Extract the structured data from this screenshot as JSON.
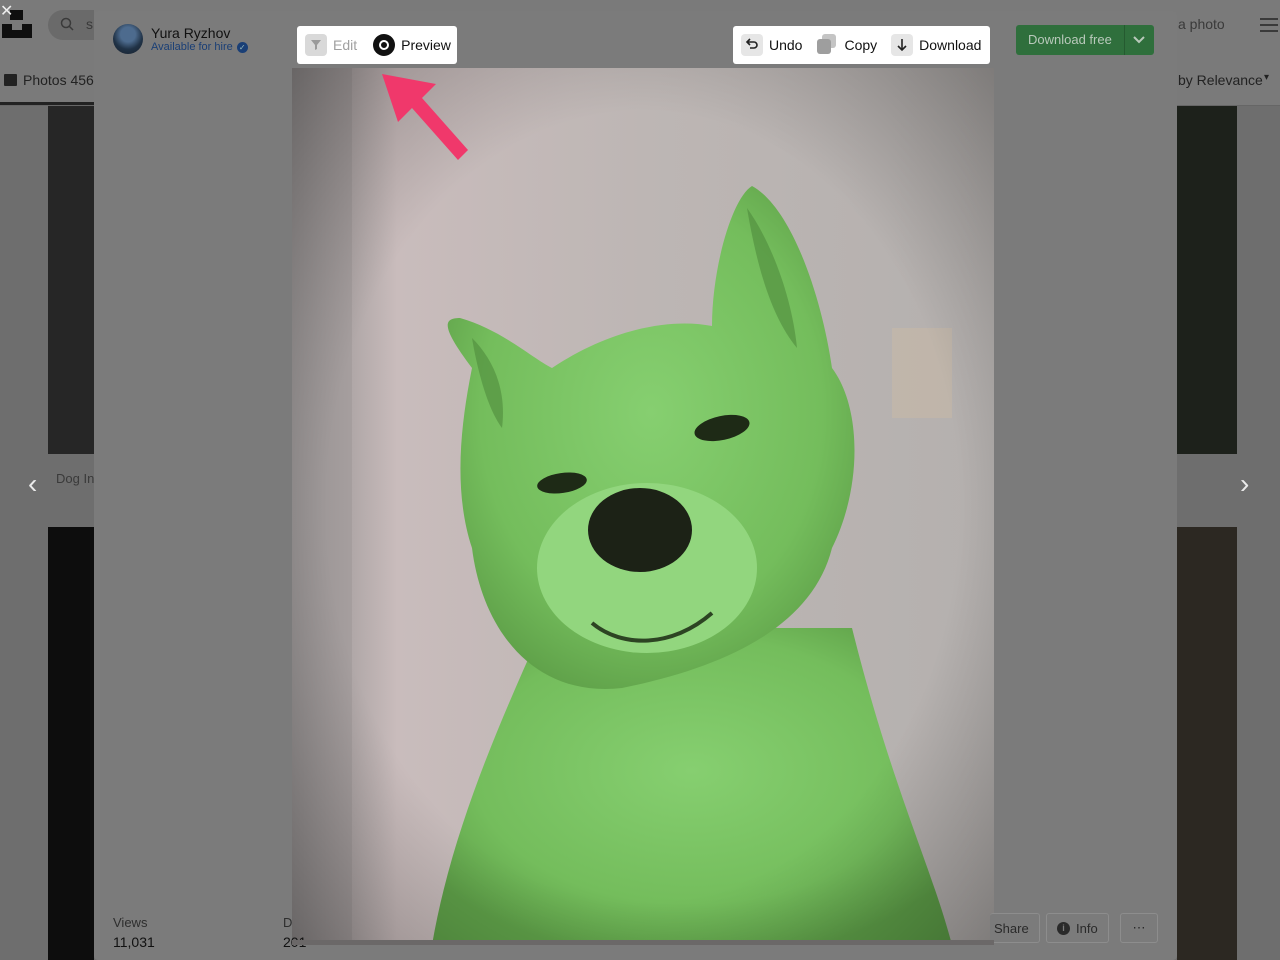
{
  "background": {
    "search_text_fragment": "s",
    "submit_text_fragment": "a photo",
    "photos_tab_label": "Photos 456",
    "sort_label": "by Relevance",
    "caption_fragment": "Dog In"
  },
  "author": {
    "name": "Yura Ryzhov",
    "status": "Available for hire"
  },
  "toolbar_left": {
    "edit_label": "Edit",
    "preview_label": "Preview"
  },
  "toolbar_right": {
    "undo_label": "Undo",
    "copy_label": "Copy",
    "download_label": "Download"
  },
  "download_free_label": "Download free",
  "stats": {
    "views_label": "Views",
    "views_value": "11,031",
    "downloads_label": "D",
    "downloads_value": "201"
  },
  "footer": {
    "share_label": "Share",
    "info_label": "Info",
    "more_label": "⋯"
  },
  "colors": {
    "accent_green": "#2f6f3c",
    "arrow": "#f0386b",
    "photo_tint": "#7ec86a"
  },
  "icons": [
    "search-icon",
    "hamburger-icon",
    "image-icon",
    "chevron-left-icon",
    "chevron-right-icon",
    "verified-icon",
    "filter-icon",
    "eye-icon",
    "undo-icon",
    "copy-icon",
    "download-arrow-icon",
    "chevron-down-icon",
    "info-icon",
    "more-icon"
  ]
}
